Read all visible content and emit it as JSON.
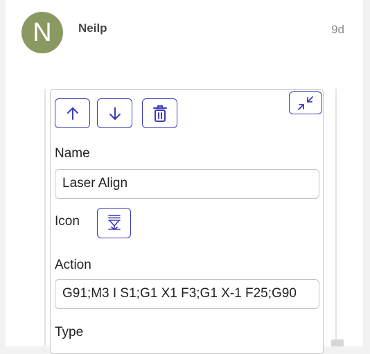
{
  "post": {
    "avatar_letter": "N",
    "username": "Neilp",
    "date": "9d"
  },
  "editor": {
    "toolbar": {
      "move_up_icon": "arrow-up-icon",
      "move_down_icon": "arrow-down-icon",
      "delete_icon": "trash-icon",
      "collapse_icon": "collapse-arrows-icon"
    },
    "name_label": "Name",
    "name_value": "Laser Align",
    "icon_label": "Icon",
    "icon_name": "laser-icon",
    "action_label": "Action",
    "action_value": "G91;M3 I S1;G1 X1 F3;G1 X-1 F25;G90",
    "type_label": "Type"
  },
  "colors": {
    "accent": "#3b3bb8",
    "avatar_bg": "#8a9862"
  }
}
